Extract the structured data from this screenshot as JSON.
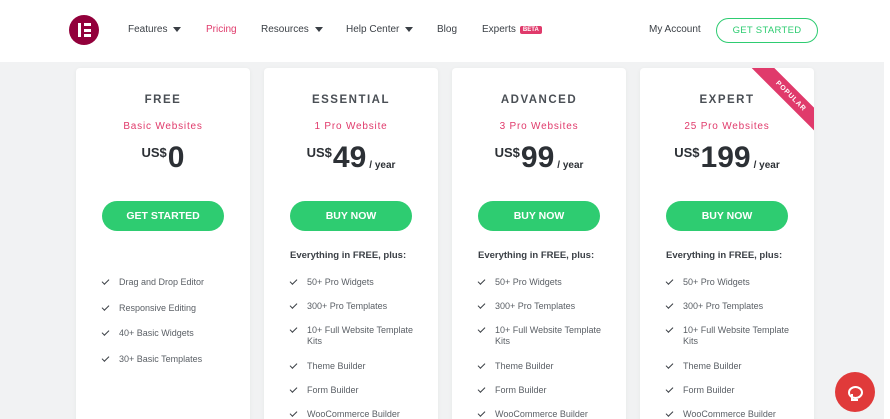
{
  "nav": {
    "items": [
      {
        "label": "Features",
        "dropdown": true
      },
      {
        "label": "Pricing",
        "active": true
      },
      {
        "label": "Resources",
        "dropdown": true
      },
      {
        "label": "Help Center",
        "dropdown": true
      },
      {
        "label": "Blog"
      },
      {
        "label": "Experts",
        "badge": "BETA"
      }
    ],
    "my_account": "My Account",
    "get_started": "GET STARTED"
  },
  "plans": [
    {
      "name": "FREE",
      "subtitle": "Basic Websites",
      "currency": "US$",
      "price": "0",
      "period": "",
      "cta": "GET STARTED",
      "plus_label": "",
      "features": [
        "Drag and Drop Editor",
        "Responsive Editing",
        "40+ Basic Widgets",
        "30+ Basic Templates"
      ]
    },
    {
      "name": "ESSENTIAL",
      "subtitle": "1 Pro Website",
      "currency": "US$",
      "price": "49",
      "period": "/ year",
      "cta": "BUY NOW",
      "plus_label": "Everything in FREE, plus:",
      "features": [
        "50+ Pro Widgets",
        "300+ Pro Templates",
        "10+ Full Website Template Kits",
        "Theme Builder",
        "Form Builder",
        "WooCommerce Builder"
      ]
    },
    {
      "name": "ADVANCED",
      "subtitle": "3 Pro Websites",
      "currency": "US$",
      "price": "99",
      "period": "/ year",
      "cta": "BUY NOW",
      "plus_label": "Everything in FREE, plus:",
      "features": [
        "50+ Pro Widgets",
        "300+ Pro Templates",
        "10+ Full Website Template Kits",
        "Theme Builder",
        "Form Builder",
        "WooCommerce Builder"
      ]
    },
    {
      "name": "EXPERT",
      "subtitle": "25 Pro Websites",
      "currency": "US$",
      "price": "199",
      "period": "/ year",
      "cta": "BUY NOW",
      "plus_label": "Everything in FREE, plus:",
      "ribbon": "POPULAR",
      "features": [
        "50+ Pro Widgets",
        "300+ Pro Templates",
        "10+ Full Website Template Kits",
        "Theme Builder",
        "Form Builder",
        "WooCommerce Builder"
      ]
    }
  ],
  "colors": {
    "accent_pink": "#e03a6b",
    "cta_green": "#2ecc71",
    "brand": "#92003b",
    "chat_red": "#e03a3a"
  },
  "icons": {
    "logo": "elementor-logo-icon",
    "check": "check-icon",
    "chat": "chat-icon"
  }
}
